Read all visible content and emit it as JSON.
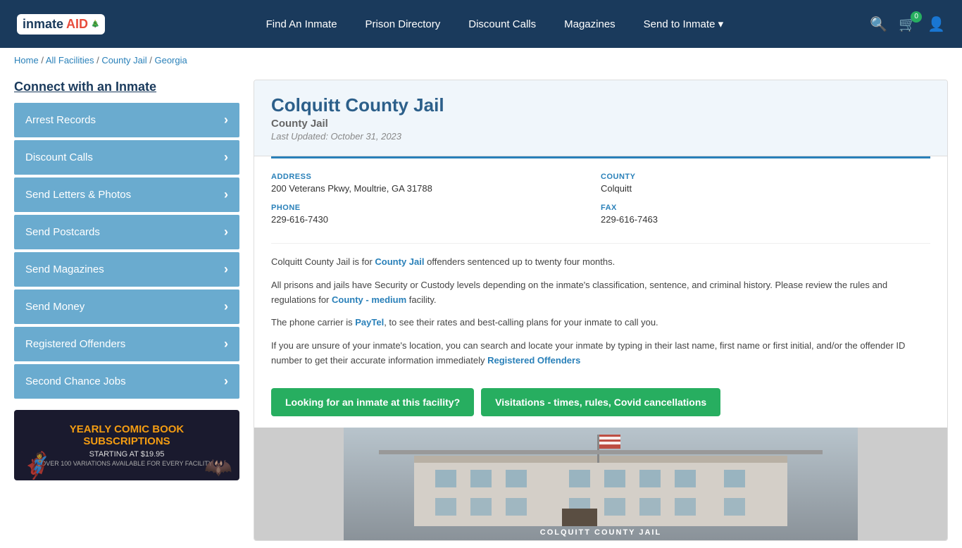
{
  "header": {
    "logo_text": "inmate",
    "logo_aid": "AID",
    "nav": [
      {
        "label": "Find An Inmate",
        "id": "find-inmate"
      },
      {
        "label": "Prison Directory",
        "id": "prison-directory"
      },
      {
        "label": "Discount Calls",
        "id": "discount-calls"
      },
      {
        "label": "Magazines",
        "id": "magazines"
      },
      {
        "label": "Send to Inmate ▾",
        "id": "send-to-inmate"
      }
    ],
    "cart_count": "0",
    "search_label": "🔍",
    "cart_label": "🛒",
    "user_label": "👤"
  },
  "breadcrumb": {
    "home": "Home",
    "all_facilities": "All Facilities",
    "county_jail": "County Jail",
    "state": "Georgia",
    "separator": " / "
  },
  "sidebar": {
    "title": "Connect with an Inmate",
    "items": [
      {
        "label": "Arrest Records",
        "id": "arrest-records"
      },
      {
        "label": "Discount Calls",
        "id": "discount-calls"
      },
      {
        "label": "Send Letters & Photos",
        "id": "send-letters"
      },
      {
        "label": "Send Postcards",
        "id": "send-postcards"
      },
      {
        "label": "Send Magazines",
        "id": "send-magazines"
      },
      {
        "label": "Send Money",
        "id": "send-money"
      },
      {
        "label": "Registered Offenders",
        "id": "registered-offenders"
      },
      {
        "label": "Second Chance Jobs",
        "id": "second-chance-jobs"
      }
    ],
    "ad": {
      "title": "YEARLY COMIC BOOK",
      "title2": "SUBSCRIPTIONS",
      "starting": "STARTING AT $19.95",
      "detail": "OVER 100 VARIATIONS AVAILABLE FOR EVERY FACILITY"
    }
  },
  "facility": {
    "name": "Colquitt County Jail",
    "type": "County Jail",
    "last_updated": "Last Updated: October 31, 2023",
    "address_label": "ADDRESS",
    "address_value": "200 Veterans Pkwy, Moultrie, GA 31788",
    "county_label": "COUNTY",
    "county_value": "Colquitt",
    "phone_label": "PHONE",
    "phone_value": "229-616-7430",
    "fax_label": "FAX",
    "fax_value": "229-616-7463",
    "desc1": "Colquitt County Jail is for County Jail offenders sentenced up to twenty four months.",
    "desc2": "All prisons and jails have Security or Custody levels depending on the inmate's classification, sentence, and criminal history. Please review the rules and regulations for County - medium facility.",
    "desc3": "The phone carrier is PayTel, to see their rates and best-calling plans for your inmate to call you.",
    "desc4": "If you are unsure of your inmate's location, you can search and locate your inmate by typing in their last name, first name or first initial, and/or the offender ID number to get their accurate information immediately Registered Offenders",
    "btn1": "Looking for an inmate at this facility?",
    "btn2": "Visitations - times, rules, Covid cancellations",
    "img_text": "COLQUITT COUNTY JAIL"
  }
}
